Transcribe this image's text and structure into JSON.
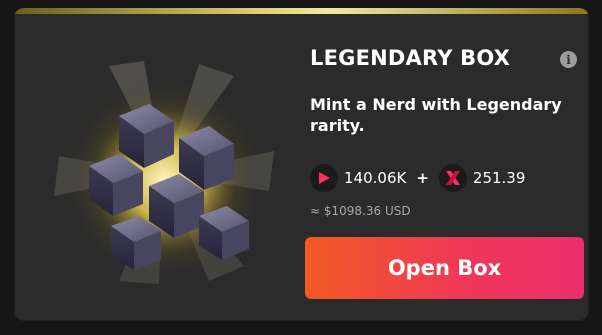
{
  "card": {
    "title": "LEGENDARY BOX",
    "info_icon": "info-icon",
    "description": "Mint a Nerd with Legendary rarity.",
    "prices": [
      {
        "icon": "play-token-icon",
        "value": "140.06K"
      },
      {
        "icon": "x-token-icon",
        "value": "251.39"
      }
    ],
    "plus": "+",
    "usd": "≈ $1098.36 USD",
    "open_button": "Open Box",
    "colors": {
      "accent_gold": "#e6d27e",
      "button_start": "#f25a24",
      "button_end": "#ec2e6c",
      "card_bg": "#2b2b2b"
    }
  }
}
